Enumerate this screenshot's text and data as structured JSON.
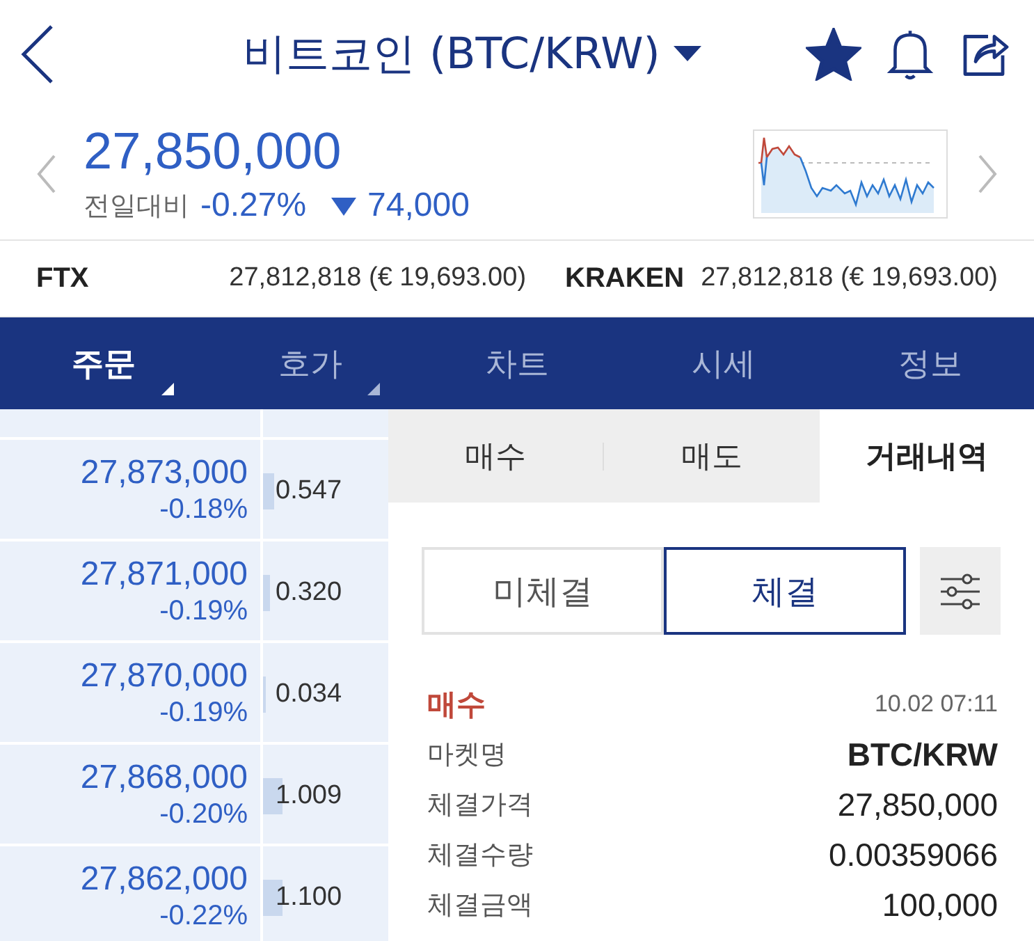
{
  "header": {
    "title": "비트코인 (BTC/KRW)",
    "favorite": true
  },
  "quote": {
    "price": "27,850,000",
    "change_label": "전일대비",
    "change_percent": "-0.27%",
    "falling": true,
    "change_amount": "74,000"
  },
  "exchanges": [
    {
      "name": "FTX",
      "value": "27,812,818 (€ 19,693.00)"
    },
    {
      "name": "KRAKEN",
      "value": "27,812,818 (€ 19,693.00)"
    }
  ],
  "tabs": [
    {
      "label": "주문",
      "selected": true,
      "has_menu": true
    },
    {
      "label": "호가",
      "selected": false,
      "has_menu": true
    },
    {
      "label": "차트",
      "selected": false,
      "has_menu": false
    },
    {
      "label": "시세",
      "selected": false,
      "has_menu": false
    },
    {
      "label": "정보",
      "selected": false,
      "has_menu": false
    }
  ],
  "order_book": [
    {
      "price": "27,873,000",
      "change": "-0.18%",
      "quantity": "0.547",
      "level": 0.09
    },
    {
      "price": "27,871,000",
      "change": "-0.19%",
      "quantity": "0.320",
      "level": 0.05
    },
    {
      "price": "27,870,000",
      "change": "-0.19%",
      "quantity": "0.034",
      "level": 0.02
    },
    {
      "price": "27,868,000",
      "change": "-0.20%",
      "quantity": "1.009",
      "level": 0.15
    },
    {
      "price": "27,862,000",
      "change": "-0.22%",
      "quantity": "1.100",
      "level": 0.16
    }
  ],
  "order_tabs": [
    {
      "label": "매수",
      "selected": false
    },
    {
      "label": "매도",
      "selected": false
    },
    {
      "label": "거래내역",
      "selected": true
    }
  ],
  "filter_tabs": [
    {
      "label": "미체결",
      "selected": false
    },
    {
      "label": "체결",
      "selected": true
    }
  ],
  "trade": {
    "side": "매수",
    "is_buy": true,
    "time": "10.02 07:11",
    "fields": [
      {
        "label": "마켓명",
        "value": "BTC/KRW",
        "bold": true
      },
      {
        "label": "체결가격",
        "value": "27,850,000",
        "bold": false
      },
      {
        "label": "체결수량",
        "value": "0.00359066",
        "bold": false
      },
      {
        "label": "체결금액",
        "value": "100,000",
        "bold": false
      }
    ]
  }
}
